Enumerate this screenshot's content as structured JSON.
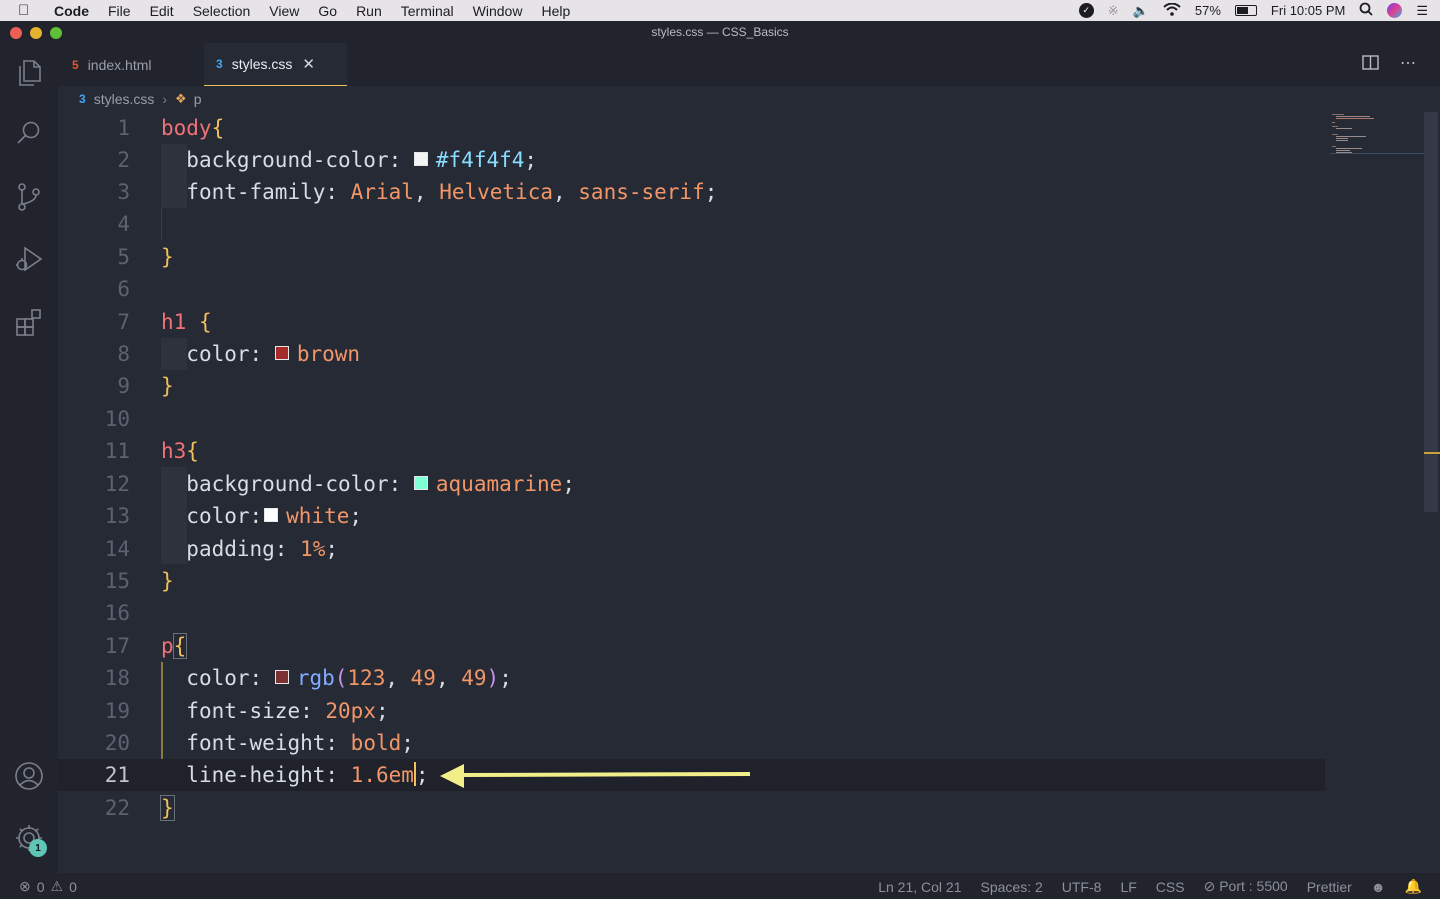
{
  "menubar": {
    "app": "Code",
    "items": [
      "File",
      "Edit",
      "Selection",
      "View",
      "Go",
      "Run",
      "Terminal",
      "Window",
      "Help"
    ],
    "battery": "57%",
    "clock": "Fri 10:05 PM"
  },
  "window": {
    "title": "styles.css — CSS_Basics"
  },
  "activity": {
    "icons": [
      "explorer-icon",
      "search-icon",
      "source-control-icon",
      "run-debug-icon",
      "extensions-icon",
      "accounts-icon",
      "manage-gear-icon"
    ],
    "settings_badge": "1"
  },
  "tabs": [
    {
      "label": "index.html",
      "icon": "html5-icon",
      "active": false
    },
    {
      "label": "styles.css",
      "icon": "css3-icon",
      "active": true
    }
  ],
  "breadcrumb": {
    "file": "styles.css",
    "symbol": "p"
  },
  "editor": {
    "current_line": 21,
    "lines": [
      {
        "n": "1"
      },
      {
        "n": "2"
      },
      {
        "n": "3"
      },
      {
        "n": "4"
      },
      {
        "n": "5"
      },
      {
        "n": "6"
      },
      {
        "n": "7"
      },
      {
        "n": "8"
      },
      {
        "n": "9"
      },
      {
        "n": "10"
      },
      {
        "n": "11"
      },
      {
        "n": "12"
      },
      {
        "n": "13"
      },
      {
        "n": "14"
      },
      {
        "n": "15"
      },
      {
        "n": "16"
      },
      {
        "n": "17"
      },
      {
        "n": "18"
      },
      {
        "n": "19"
      },
      {
        "n": "20"
      },
      {
        "n": "21"
      },
      {
        "n": "22"
      }
    ],
    "tokens": {
      "l1_sel": "body",
      "l1_b": "{",
      "l2_prop": "background-color:",
      "l2_val": "#f4f4f4",
      "l2_sw": "#f4f4f4",
      "l3_prop": "font-family:",
      "l3_v1": "Arial",
      "l3_v2": "Helvetica",
      "l3_v3": "sans-serif",
      "l5_b": "}",
      "l7_sel": "h1",
      "l7_b": "{",
      "l8_prop": "color:",
      "l8_val": "brown",
      "l8_sw": "#a52a2a",
      "l9_b": "}",
      "l11_sel": "h3",
      "l11_b": "{",
      "l12_prop": "background-color:",
      "l12_val": "aquamarine",
      "l12_sw": "#7fffd4",
      "l13_prop": "color:",
      "l13_val": "white",
      "l13_sw": "#ffffff",
      "l14_prop": "padding:",
      "l14_val": "1%",
      "l15_b": "}",
      "l17_sel": "p",
      "l17_b": "{",
      "l18_prop": "color:",
      "l18_fn": "rgb",
      "l18_a": "123",
      "l18_b": "49",
      "l18_c": "49",
      "l18_sw": "#7b3131",
      "l19_prop": "font-size:",
      "l19_val": "20px",
      "l20_prop": "font-weight:",
      "l20_val": "bold",
      "l21_prop": "line-height:",
      "l21_val": "1.6em",
      "l22_b": "}"
    }
  },
  "statusbar": {
    "errors": "0",
    "warnings": "0",
    "position": "Ln 21, Col 21",
    "spaces": "Spaces: 2",
    "encoding": "UTF-8",
    "eol": "LF",
    "language": "CSS",
    "port": "Port : 5500",
    "formatter": "Prettier"
  },
  "colors": {
    "accent_yellow": "#f1c05a",
    "annotation_arrow": "#f2ee8a"
  }
}
